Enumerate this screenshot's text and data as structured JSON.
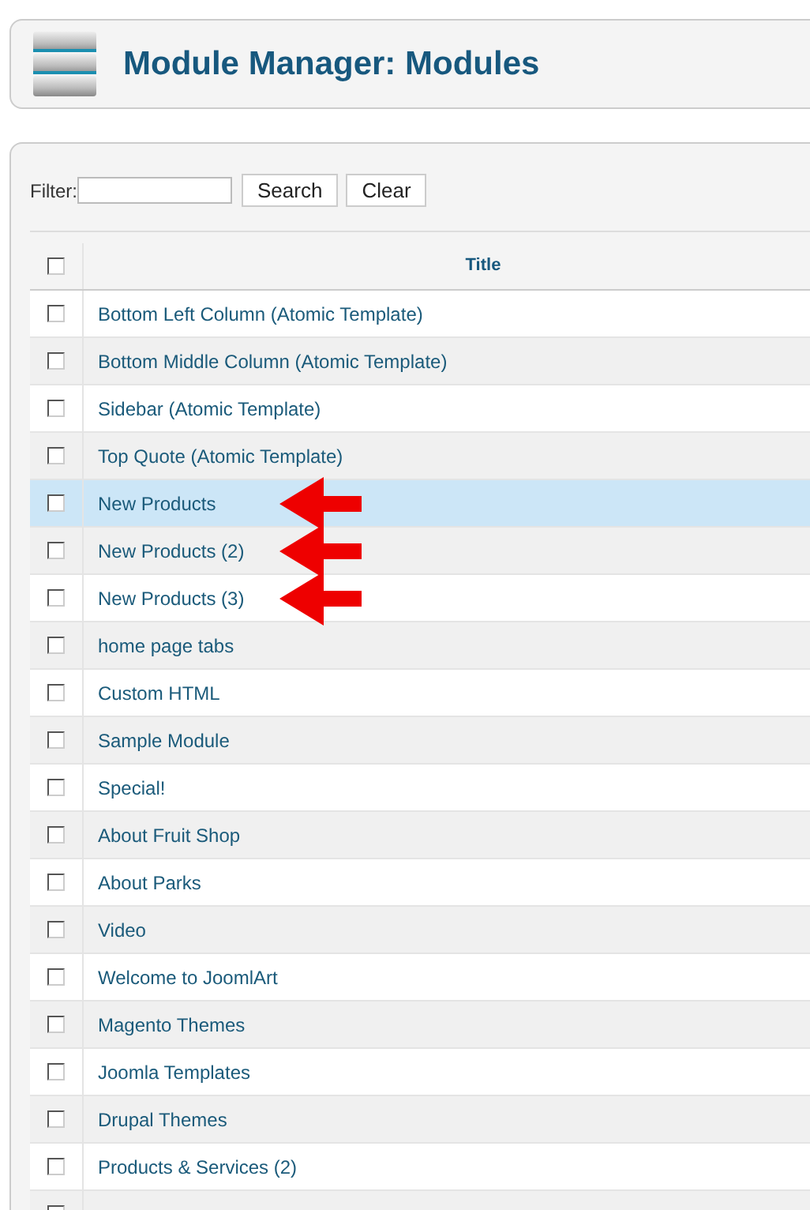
{
  "header": {
    "title": "Module Manager: Modules"
  },
  "filter": {
    "label": "Filter:",
    "buttons": [
      "Search",
      "Clear"
    ]
  },
  "table": {
    "columns": [
      {
        "label": "Title",
        "checked": false
      }
    ],
    "rows": [
      {
        "title": "Bottom Left Column (Atomic Template)",
        "checked": false,
        "highlighted": false,
        "arrow": false
      },
      {
        "title": "Bottom Middle Column (Atomic Template)",
        "checked": false,
        "highlighted": false,
        "arrow": false
      },
      {
        "title": "Sidebar (Atomic Template)",
        "checked": false,
        "highlighted": false,
        "arrow": false
      },
      {
        "title": "Top Quote (Atomic Template)",
        "checked": false,
        "highlighted": false,
        "arrow": false
      },
      {
        "title": "New Products",
        "checked": false,
        "highlighted": true,
        "arrow": true
      },
      {
        "title": "New Products (2)",
        "checked": false,
        "highlighted": false,
        "arrow": true
      },
      {
        "title": "New Products (3)",
        "checked": false,
        "highlighted": false,
        "arrow": true
      },
      {
        "title": "home page tabs",
        "checked": false,
        "highlighted": false,
        "arrow": false
      },
      {
        "title": "Custom HTML",
        "checked": false,
        "highlighted": false,
        "arrow": false
      },
      {
        "title": "Sample Module",
        "checked": false,
        "highlighted": false,
        "arrow": false
      },
      {
        "title": "Special!",
        "checked": false,
        "highlighted": false,
        "arrow": false
      },
      {
        "title": "About Fruit Shop",
        "checked": false,
        "highlighted": false,
        "arrow": false
      },
      {
        "title": "About Parks",
        "checked": false,
        "highlighted": false,
        "arrow": false
      },
      {
        "title": "Video",
        "checked": false,
        "highlighted": false,
        "arrow": false
      },
      {
        "title": "Welcome to JoomlArt",
        "checked": false,
        "highlighted": false,
        "arrow": false
      },
      {
        "title": "Magento Themes",
        "checked": false,
        "highlighted": false,
        "arrow": false
      },
      {
        "title": "Joomla Templates",
        "checked": false,
        "highlighted": false,
        "arrow": false
      },
      {
        "title": "Drupal Themes",
        "checked": false,
        "highlighted": false,
        "arrow": false
      },
      {
        "title": "Products & Services (2)",
        "checked": false,
        "highlighted": false,
        "arrow": false
      },
      {
        "checked": false,
        "highlighted": false,
        "arrow": false
      }
    ]
  }
}
